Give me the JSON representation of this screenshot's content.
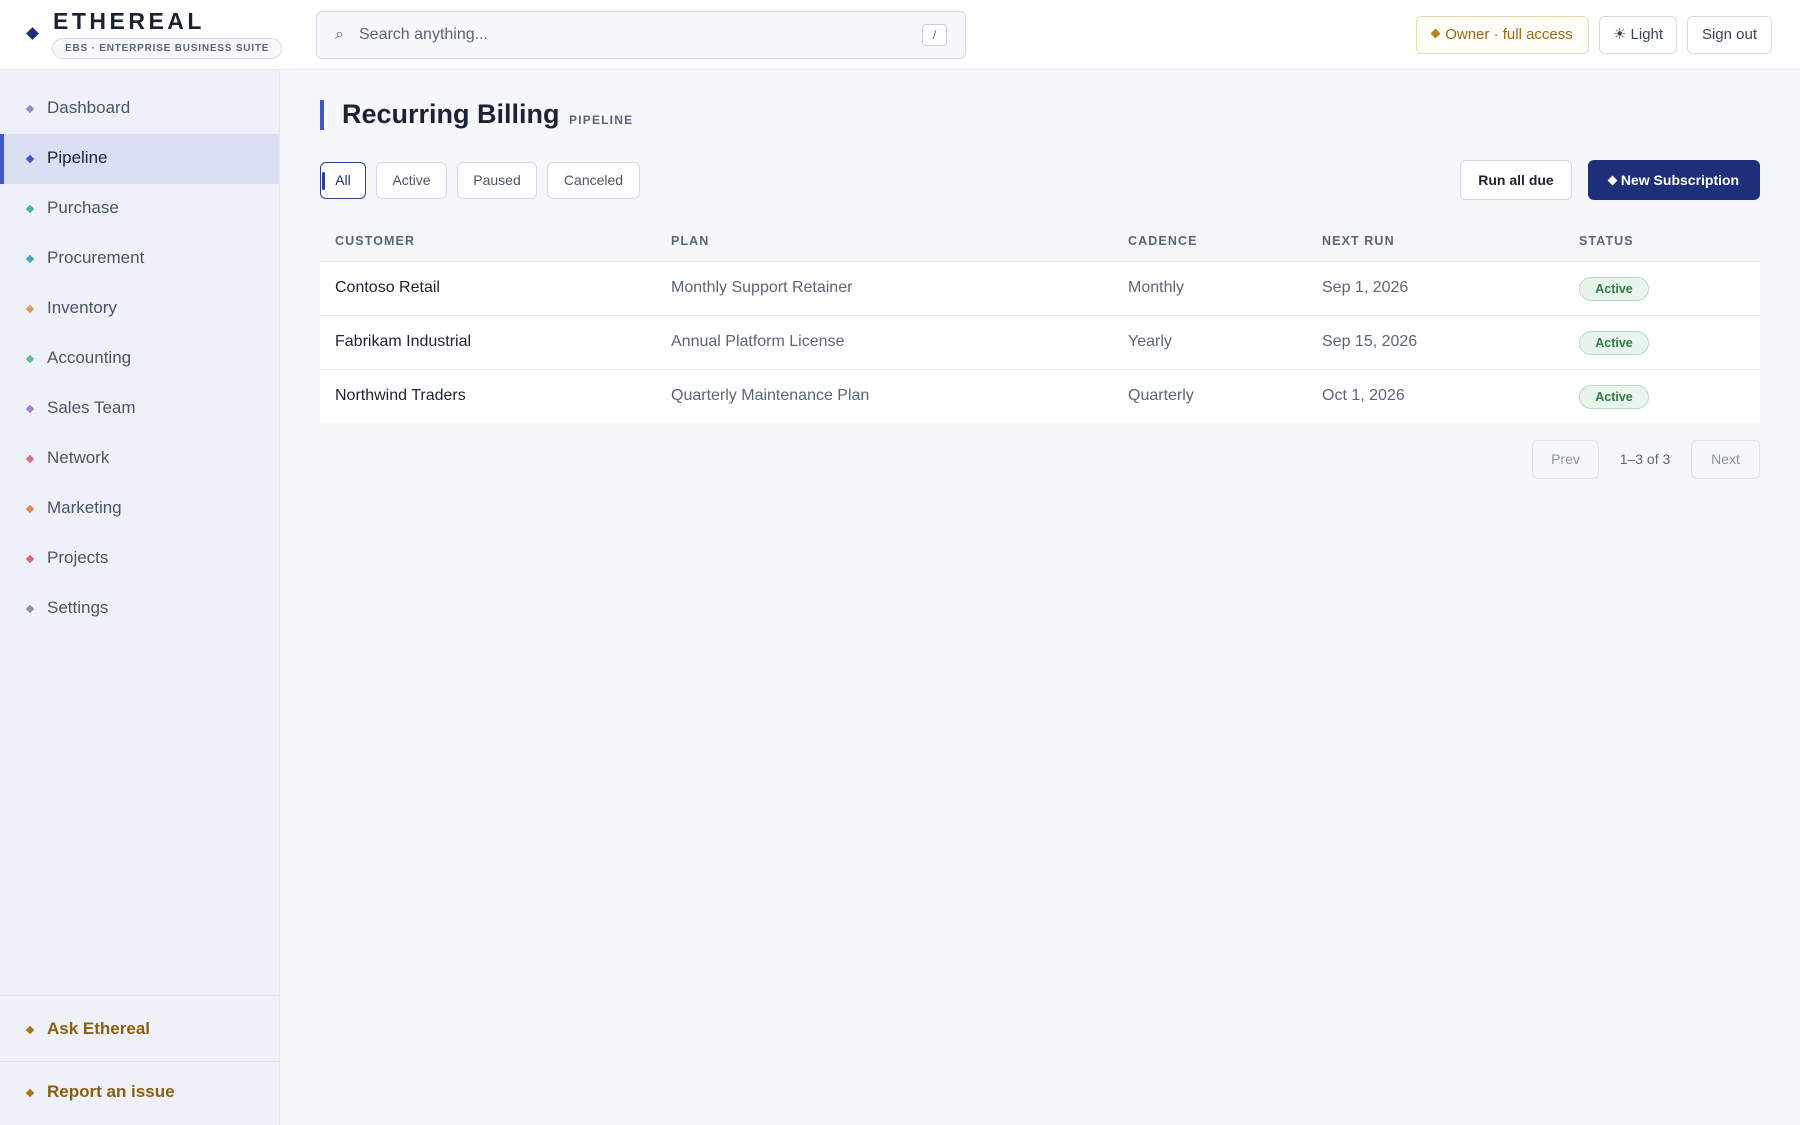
{
  "brand": {
    "name": "ETHEREAL",
    "subtitle": "EBS · ENTERPRISE BUSINESS SUITE"
  },
  "search": {
    "placeholder": "Search anything...",
    "shortcut": "/",
    "icon": "search-icon"
  },
  "header": {
    "role_label": "Owner · full access",
    "theme_label": "☀ Light",
    "signout_label": "Sign out"
  },
  "sidebar": {
    "items": [
      {
        "label": "Dashboard",
        "color": "#8a93c9"
      },
      {
        "label": "Pipeline",
        "color": "#3f58c7",
        "active": true
      },
      {
        "label": "Purchase",
        "color": "#4fb3a0"
      },
      {
        "label": "Procurement",
        "color": "#4aa3c9"
      },
      {
        "label": "Inventory",
        "color": "#d9a05b"
      },
      {
        "label": "Accounting",
        "color": "#5fbf8a"
      },
      {
        "label": "Sales Team",
        "color": "#a77fd6"
      },
      {
        "label": "Network",
        "color": "#d9708a"
      },
      {
        "label": "Marketing",
        "color": "#e08a5b"
      },
      {
        "label": "Projects",
        "color": "#e06a7a"
      },
      {
        "label": "Settings",
        "color": "#8a93a4"
      }
    ],
    "footer": {
      "ask_label": "Ask Ethereal",
      "report_label": "Report an issue"
    }
  },
  "page": {
    "title": "Recurring Billing",
    "tag": "PIPELINE"
  },
  "filters": {
    "chips": [
      "All",
      "Active",
      "Paused",
      "Canceled"
    ],
    "selected": "All"
  },
  "actions": {
    "run_label": "Run all due",
    "new_label": "New Subscription"
  },
  "table": {
    "columns": [
      "CUSTOMER",
      "PLAN",
      "CADENCE",
      "NEXT RUN",
      "STATUS"
    ],
    "rows": [
      {
        "customer": "Contoso Retail",
        "plan": "Monthly Support Retainer",
        "cadence": "Monthly",
        "next_run": "Sep 1, 2026",
        "status": "Active"
      },
      {
        "customer": "Fabrikam Industrial",
        "plan": "Annual Platform License",
        "cadence": "Yearly",
        "next_run": "Sep 15, 2026",
        "status": "Active"
      },
      {
        "customer": "Northwind Traders",
        "plan": "Quarterly Maintenance Plan",
        "cadence": "Quarterly",
        "next_run": "Oct 1, 2026",
        "status": "Active"
      }
    ]
  },
  "pager": {
    "prev_label": "Prev",
    "info": "1–3 of 3",
    "next_label": "Next"
  },
  "colors": {
    "accent": "#3f58c7",
    "primary_button": "#1e2f7a",
    "status_active": "#2e7d46",
    "footer_gold": "#8b5e10"
  }
}
